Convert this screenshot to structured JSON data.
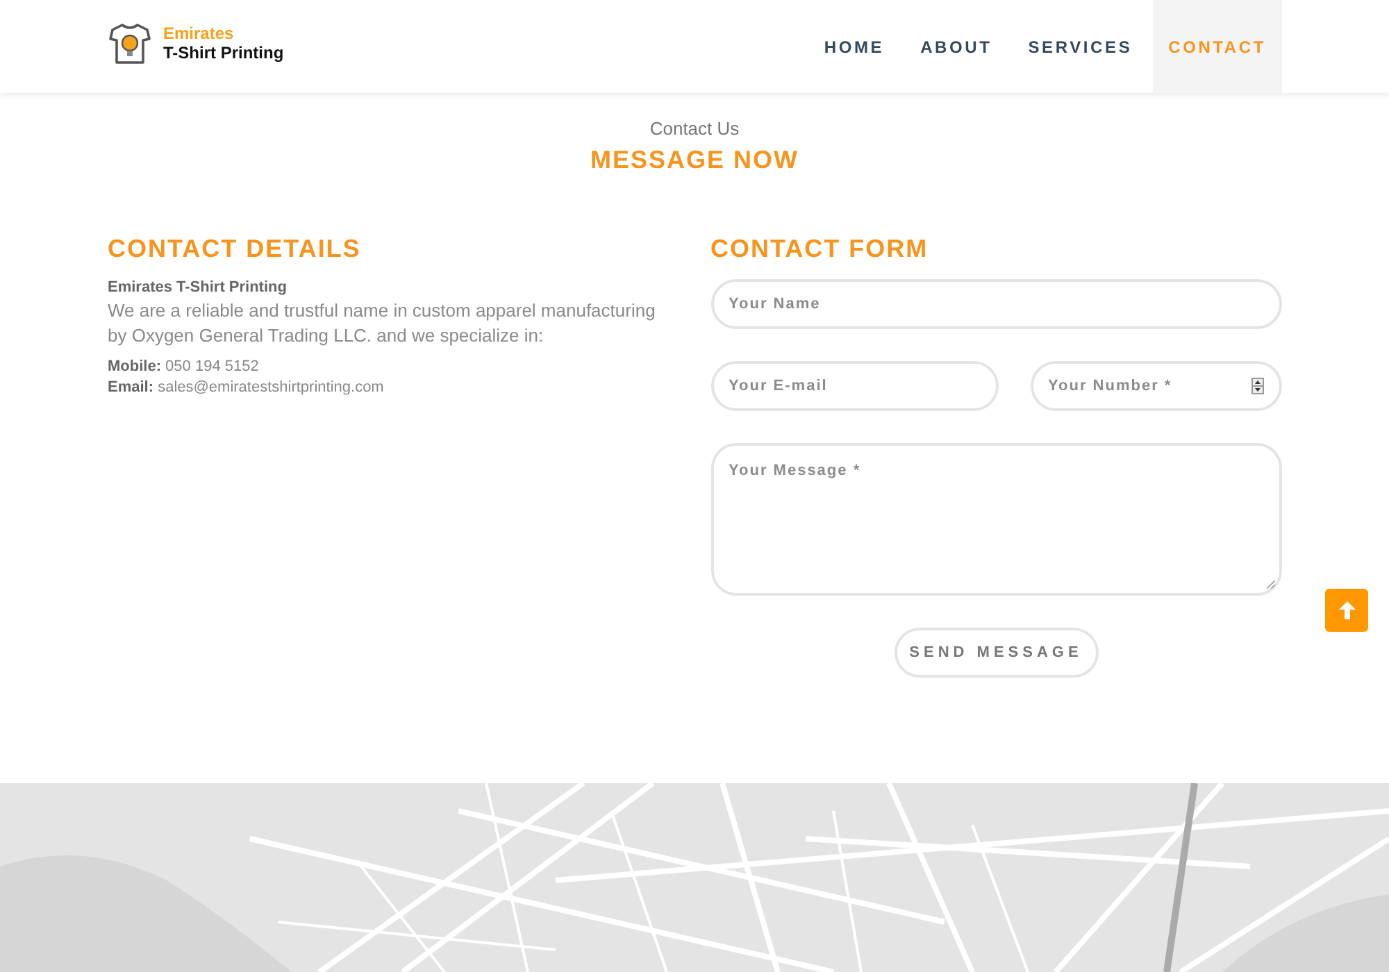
{
  "header": {
    "logo": {
      "line_1": "Emirates",
      "line_2": "T-Shirt Printing"
    },
    "nav": [
      {
        "label": "HOME",
        "selected": false
      },
      {
        "label": "ABOUT",
        "selected": false
      },
      {
        "label": "SERVICES",
        "selected": false
      },
      {
        "label": "CONTACT",
        "selected": true
      }
    ]
  },
  "intro": {
    "subtitle": "Contact Us",
    "title": "MESSAGE NOW"
  },
  "contact_details": {
    "heading": "CONTACT DETAILS",
    "company": "Emirates T-Shirt Printing",
    "description": "We are a reliable and trustful name in custom apparel manufacturing by Oxygen General Trading LLC. and we specialize in:",
    "lines": [
      "**Mobile:** 050 194 5152",
      "**Email:** sales@emiratestshirtprinting.com"
    ]
  },
  "contact_form": {
    "heading": "CONTACT FORM",
    "rows": [
      [
        {
          "kind": "text",
          "placeholder": "Your Name"
        }
      ],
      [
        {
          "kind": "text",
          "placeholder": "Your E-mail"
        },
        {
          "kind": "number",
          "placeholder": "Your Number *"
        }
      ],
      [
        {
          "kind": "textarea",
          "placeholder": "Your Message *"
        }
      ]
    ],
    "submit": "SEND MESSAGE"
  }
}
